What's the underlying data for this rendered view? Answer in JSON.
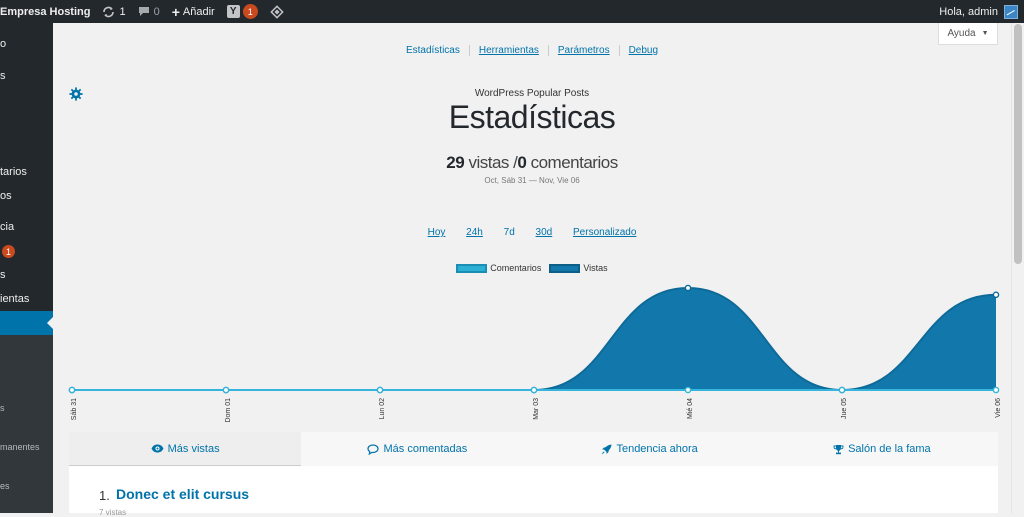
{
  "adminbar": {
    "site_name": "Empresa Hosting",
    "updates_count": "1",
    "comments_count": "0",
    "add_label": "Añadir",
    "yoast_count": "1",
    "greeting": "Hola, admin"
  },
  "sidebar": {
    "items": [
      {
        "label": "o"
      },
      {
        "label": "s"
      },
      {
        "label": "tarios"
      },
      {
        "label": "os"
      },
      {
        "label": "cia"
      },
      {
        "label": "s"
      },
      {
        "label": "ientas"
      },
      {
        "label": "s"
      },
      {
        "label": "manentes"
      },
      {
        "label": "es"
      }
    ],
    "badge": "1"
  },
  "help": {
    "label": "Ayuda"
  },
  "subnav": [
    "Estadísticas",
    "Herramientas",
    "Parámetros",
    "Debug"
  ],
  "page": {
    "plugin_name": "WordPress Popular Posts",
    "title": "Estadísticas",
    "views_count": "29",
    "views_label": "vistas",
    "separator": "/",
    "comments_count": "0",
    "comments_label": "comentarios",
    "date_range": "Oct, Sáb 31 — Nov, Vie 06"
  },
  "ranges": [
    "Hoy",
    "24h",
    "7d",
    "30d",
    "Personalizado"
  ],
  "colors": {
    "comments": "#2db0d6",
    "views": "#1278ab",
    "accent": "#0073aa"
  },
  "chart_data": {
    "type": "area",
    "categories": [
      "Sáb 31",
      "Dom 01",
      "Lun 02",
      "Mar 03",
      "Mié 04",
      "Jue 05",
      "Vie 06"
    ],
    "series": [
      {
        "name": "Comentarios",
        "values": [
          0,
          0,
          0,
          0,
          0,
          0,
          0
        ]
      },
      {
        "name": "Vistas",
        "values": [
          0,
          0,
          0,
          0,
          15,
          0,
          14
        ]
      }
    ],
    "legend": "top-center",
    "grid": false
  },
  "tabs": [
    {
      "label": "Más vistas",
      "icon": "eye-icon"
    },
    {
      "label": "Más comentadas",
      "icon": "comment-icon"
    },
    {
      "label": "Tendencia ahora",
      "icon": "rocket-icon"
    },
    {
      "label": "Salón de la fama",
      "icon": "trophy-icon"
    }
  ],
  "list": [
    {
      "rank": "1.",
      "title": "Donec et elit cursus",
      "meta": "7 vistas"
    }
  ]
}
